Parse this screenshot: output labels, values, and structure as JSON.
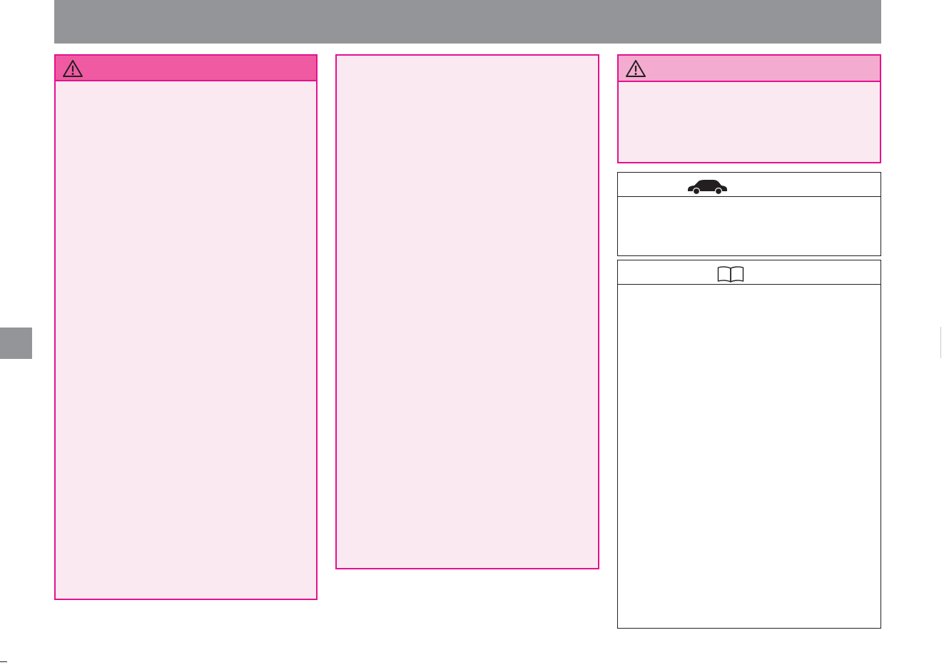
{
  "header": {
    "background_color": "#939598"
  },
  "side_tab": {
    "color": "#939598"
  },
  "boxes": {
    "warning_left": {
      "icon": "warning-triangle-icon",
      "header_color": "#ef5aa2",
      "border_color": "#e4118e",
      "body_color": "#fae9f1"
    },
    "pink_panel": {
      "border_color": "#e4118e",
      "body_color": "#fae9f1"
    },
    "warning_right": {
      "icon": "warning-triangle-icon",
      "header_color": "#f4abd0",
      "border_color": "#e4118e",
      "body_color": "#fae9f1"
    },
    "vehicle_note": {
      "icon": "car-icon",
      "border_color": "#231f20"
    },
    "reference_note": {
      "icon": "open-book-icon",
      "border_color": "#231f20"
    }
  }
}
